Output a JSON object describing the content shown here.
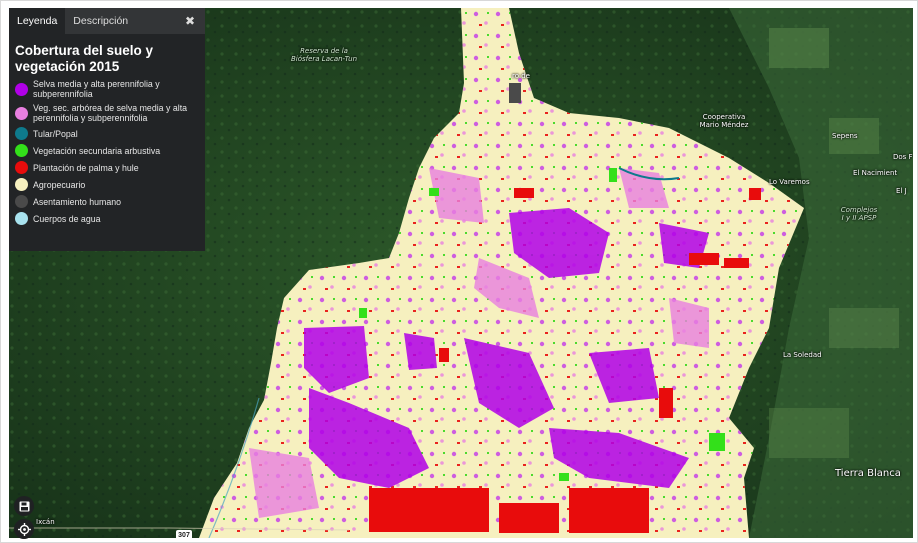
{
  "legend_panel": {
    "tabs": [
      {
        "label": "Leyenda",
        "active": true
      },
      {
        "label": "Descripción",
        "active": false
      }
    ],
    "close_icon": "close-icon",
    "title_line1": "Cobertura del suelo y",
    "title_line2": "vegetación 2015",
    "items": [
      {
        "label": "Selva media y alta perennifolia y subperennifolia",
        "color": "#b100e8"
      },
      {
        "label": "Veg. sec. arbórea de selva media y alta perennifolia y subperennifolia",
        "color": "#e87fe0"
      },
      {
        "label": "Tular/Popal",
        "color": "#0e7a8c"
      },
      {
        "label": "Vegetación secundaria arbustiva",
        "color": "#33e01a"
      },
      {
        "label": "Plantación de palma y hule",
        "color": "#e80c0c"
      },
      {
        "label": "Agropecuario",
        "color": "#f6f0bf"
      },
      {
        "label": "Asentamiento humano",
        "color": "#4a4a4a"
      },
      {
        "label": "Cuerpos de agua",
        "color": "#a8e2ee"
      }
    ]
  },
  "map_labels": {
    "reserva_line1": "Reserva de la",
    "reserva_line2": "Biósfera Lacan-Tun",
    "frontera": "ro de",
    "cooperativa_line1": "Cooperativa",
    "cooperativa_line2": "Mario Méndez",
    "sepens": "Sepens",
    "dos": "Dos F",
    "el_nacimiento": "El Nacimient",
    "el_j": "El J",
    "lo_varemos": "Lo Varemos",
    "complejos_line1": "Complejos",
    "complejos_line2": "I y II APSP",
    "la_soledad": "La Soledad",
    "tierra_blanca": "Tierra Blanca",
    "ixcan": "Ixcán",
    "road_shield": "307"
  },
  "controls": {
    "save_icon": "save-icon",
    "locate_icon": "crosshair-icon"
  }
}
